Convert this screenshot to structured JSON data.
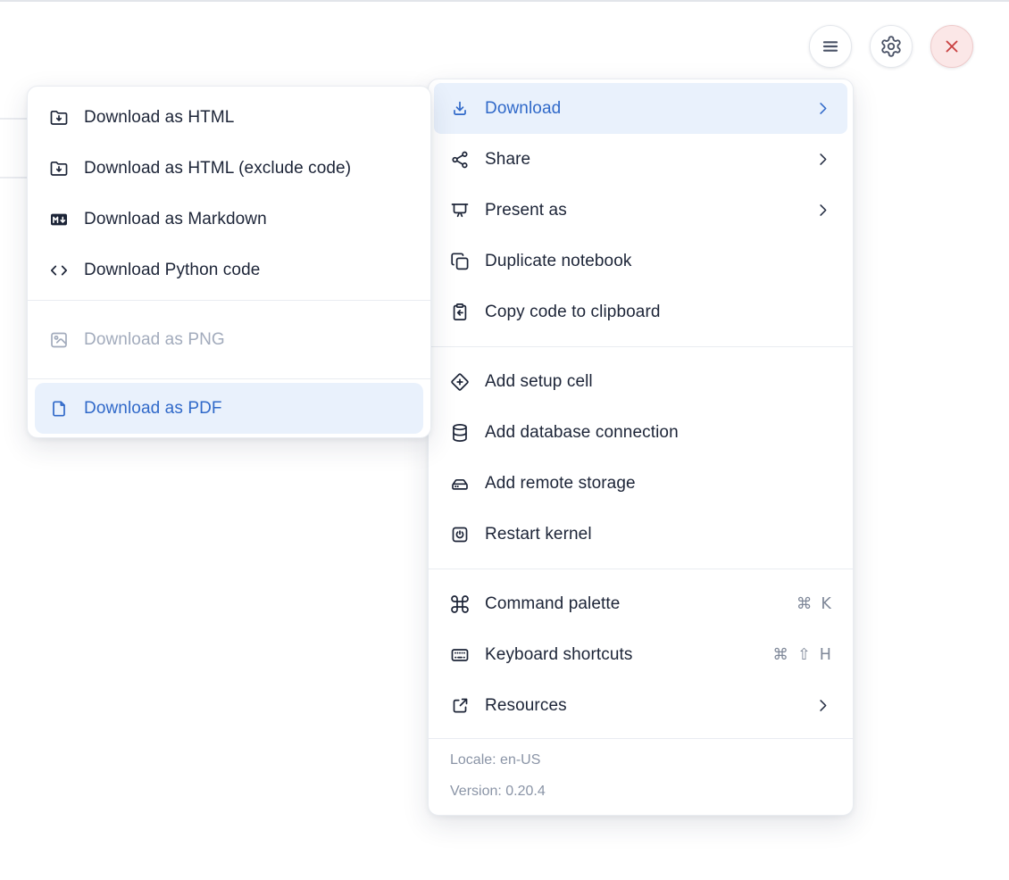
{
  "toolbar": {
    "buttons": [
      {
        "id": "hamburger-menu",
        "icon": "hamburger"
      },
      {
        "id": "settings",
        "icon": "gear"
      },
      {
        "id": "close",
        "icon": "close"
      }
    ]
  },
  "main_menu": {
    "sections": [
      {
        "items": [
          {
            "id": "download",
            "icon": "download",
            "label": "Download",
            "trailing": {
              "type": "chevron"
            },
            "highlighted": true
          },
          {
            "id": "share",
            "icon": "share",
            "label": "Share",
            "trailing": {
              "type": "chevron"
            }
          },
          {
            "id": "present-as",
            "icon": "presentation",
            "label": "Present as",
            "trailing": {
              "type": "chevron"
            }
          },
          {
            "id": "duplicate-notebook",
            "icon": "duplicate",
            "label": "Duplicate notebook"
          },
          {
            "id": "copy-code-to-clipboard",
            "icon": "clipboard-arrow",
            "label": "Copy code to clipboard"
          }
        ]
      },
      {
        "items": [
          {
            "id": "add-setup-cell",
            "icon": "diamond-plus",
            "label": "Add setup cell"
          },
          {
            "id": "add-database-connection",
            "icon": "database",
            "label": "Add database connection"
          },
          {
            "id": "add-remote-storage",
            "icon": "hard-drive",
            "label": "Add remote storage"
          },
          {
            "id": "restart-kernel",
            "icon": "power-square",
            "label": "Restart kernel"
          }
        ]
      },
      {
        "items": [
          {
            "id": "command-palette",
            "icon": "command",
            "label": "Command palette",
            "trailing": {
              "type": "shortcut",
              "keys": [
                "⌘",
                "K"
              ]
            }
          },
          {
            "id": "keyboard-shortcuts",
            "icon": "keyboard",
            "label": "Keyboard shortcuts",
            "trailing": {
              "type": "shortcut",
              "keys": [
                "⌘",
                "⇧",
                "H"
              ]
            }
          },
          {
            "id": "resources",
            "icon": "external-link",
            "label": "Resources",
            "trailing": {
              "type": "chevron"
            }
          }
        ]
      }
    ],
    "footer": {
      "locale": "Locale: en-US",
      "version": "Version: 0.20.4"
    }
  },
  "download_submenu": {
    "sections": [
      {
        "items": [
          {
            "id": "download-as-html",
            "icon": "folder-download",
            "label": "Download as HTML"
          },
          {
            "id": "download-as-html-exclude-code",
            "icon": "folder-download",
            "label": "Download as HTML (exclude code)"
          },
          {
            "id": "download-as-markdown",
            "icon": "markdown",
            "label": "Download as Markdown"
          },
          {
            "id": "download-python-code",
            "icon": "code",
            "label": "Download Python code"
          }
        ]
      },
      {
        "items": [
          {
            "id": "download-as-png",
            "icon": "image",
            "label": "Download as PNG",
            "disabled": true
          }
        ]
      },
      {
        "items": [
          {
            "id": "download-as-pdf",
            "icon": "file",
            "label": "Download as PDF",
            "highlighted": true
          }
        ]
      }
    ]
  },
  "colors": {
    "accent": "#3069c9",
    "highlight_bg": "#e9f1fc",
    "text": "#1c2437",
    "muted_text": "#7e8798",
    "footer_text": "#8a94a6",
    "disabled_text": "#a2abbc",
    "danger": "#c94141",
    "danger_bg": "#fbe7e7",
    "divider": "#e9ecf1"
  }
}
